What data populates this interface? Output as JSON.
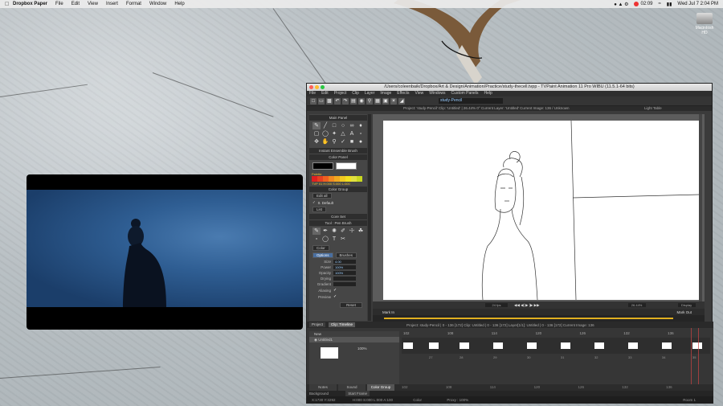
{
  "menubar": {
    "app": "Dropbox Paper",
    "items": [
      "File",
      "Edit",
      "View",
      "Insert",
      "Format",
      "Window",
      "Help"
    ],
    "record_time": "02:09",
    "clock": "Wed Jul 7  2:04 PM"
  },
  "desktop": {
    "drive_label": "Macintosh HD"
  },
  "tvpaint": {
    "title": "/Users/coleenbaik/Dropbox/Art & Design/Animation/Practice/study-thecell.tvpp - TVPaint Animation 11 Pro WIBU (11.5.1-64 bits)",
    "menu": [
      "File",
      "Edit",
      "Project",
      "Clip",
      "Layer",
      "Image",
      "Effects",
      "View",
      "Windows",
      "Custom Panels",
      "Help"
    ],
    "layer_field": "study-Pencil",
    "project_info": "Project: 'study-Pencil'   Clip: 'Untitled' | 26.44%   0°   Current Layer: 'Untitled'   Current Image: 136 / Unknown",
    "lighttable": "Light Table",
    "panels": {
      "main": "Main Panel",
      "instant_brush": "Instant Ensemble Brush",
      "color": "Color Panel",
      "palette_label": "Palette",
      "tvp_info": "TVP 01 H:000 S:000 L:000",
      "color_group": "Color Group",
      "edit_all": "Edit all",
      "default": "0. Default",
      "list": "List",
      "core_set": "Core Set",
      "tool_pen": "Tool : Pen Brush",
      "mode": "Color"
    },
    "options": {
      "tab": "Options",
      "tab2": "Brushes",
      "size_label": "Size",
      "size": "4.00",
      "power_label": "Power",
      "power": "100%",
      "opacity_label": "Opacity",
      "opacity": "100%",
      "drying_label": "Drying",
      "gradient_label": "Gradient",
      "aliasing_label": "Aliasing",
      "preview_label": "Preview",
      "reset": "Reset"
    },
    "nav": {
      "zoom": "26.44%",
      "display": "Display",
      "fps": "24 fps",
      "mark_in": "Mark In",
      "mark_out": "Mark Out"
    },
    "timeline": {
      "tab_project": "Project",
      "tab_timeline": "Clip: Timeline",
      "info": "Project: study-Pencil | 0 - 136 [172]    Clip: Untitled | 0 - 136 [172]    Layer[1/1]: Untitled | 0 - 136 [172]    Current Image: 136",
      "new_label": "New",
      "layer_name": "Untitled1",
      "opacity": "100%",
      "frames": [
        "102",
        "108",
        "114",
        "120",
        "126",
        "132",
        "136"
      ],
      "cell_numbers": [
        "27",
        "28",
        "29",
        "30",
        "31",
        "32",
        "33",
        "34",
        "35"
      ],
      "footer_tabs": [
        "Notes",
        "Sound",
        "Color Group"
      ],
      "background": "Background",
      "start_frame": "Start Frame",
      "coords": "X:1730  Y:3292",
      "hsl": "H:000 S:000 L:000 A:100",
      "color_label": "Color",
      "proxy": "Proxy : 100%",
      "room": "Room 1"
    }
  }
}
